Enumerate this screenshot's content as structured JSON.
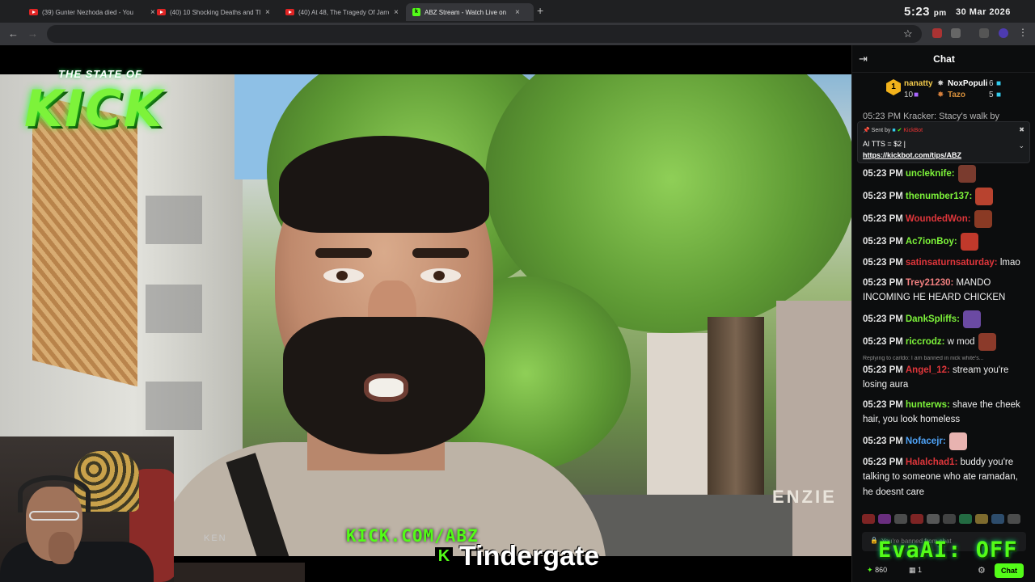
{
  "browser": {
    "tabs": [
      {
        "title": "(39) Gunter Nezhoda died - You",
        "icon": "youtube-icon"
      },
      {
        "title": "(40) 10 Shocking Deaths and Th",
        "icon": "youtube-icon"
      },
      {
        "title": "(40) At 48, The Tragedy Of Jarro",
        "icon": "youtube-icon"
      },
      {
        "title": "ABZ Stream - Watch Live on",
        "icon": "kick-icon"
      }
    ],
    "new_tab": "+",
    "close": "×"
  },
  "overlay": {
    "clock_time": "5:23",
    "clock_ampm": "pm",
    "date": "30 Mar 2026",
    "logo_top": "THE STATE OF",
    "logo_main": "KICK",
    "kick_url": "KICK.COM/ABZ",
    "caption_k": "K",
    "caption": "Tindergate",
    "eva_ai": "EvaAI: OFF",
    "video_sign": "ENZIE",
    "video_watermark": "KEN"
  },
  "chat": {
    "title": "Chat",
    "leaderboard": {
      "rank": "1",
      "first": {
        "name": "nanatty",
        "count": "10"
      },
      "second": {
        "name": "NoxPopuli",
        "count": "6"
      },
      "third": {
        "name": "Tazo",
        "count": "5"
      }
    },
    "behind_message": "05:23 PM Kracker: Stacy's walk by",
    "pinned": {
      "sent_by": "Sent by",
      "bot": "KickBot",
      "line": "AI TTS = $2 |",
      "link": "https://kickbot.com/tips/ABZ"
    },
    "messages": [
      {
        "time": "05:23 PM",
        "user": "uncleknife:",
        "color": "#7df33a",
        "text": "",
        "emote": "#7a3b2e"
      },
      {
        "time": "05:23 PM",
        "user": "thenumber137:",
        "color": "#7df33a",
        "text": "",
        "emote": "#b8432f"
      },
      {
        "time": "05:23 PM",
        "user": "WoundedWon:",
        "color": "#e0363b",
        "text": "",
        "emote": "#8a3a24"
      },
      {
        "time": "05:23 PM",
        "user": "Ac7ionBoy:",
        "color": "#7df33a",
        "text": "",
        "emote": "#c0392b"
      },
      {
        "time": "05:23 PM",
        "user": "satinsaturnsaturday:",
        "color": "#e0363b",
        "text": "lmao",
        "emote": ""
      },
      {
        "time": "05:23 PM",
        "user": "Trey21230:",
        "color": "#f07f7f",
        "text": "MANDO INCOMING HE HEARD CHICKEN",
        "emote": ""
      },
      {
        "time": "05:23 PM",
        "user": "DankSpliffs:",
        "color": "#7df33a",
        "text": "",
        "emote": "#6b4aa3"
      },
      {
        "time": "05:23 PM",
        "user": "riccrodz:",
        "color": "#7df33a",
        "text": "w mod",
        "emote": "#8b3a2a"
      },
      {
        "time": "05:23 PM",
        "user": "Angel_12:",
        "color": "#e0363b",
        "text": "stream you're losing aura",
        "emote": "",
        "reply": "Replying to carldo: I am banned in nick white's..."
      },
      {
        "time": "05:23 PM",
        "user": "hunterws:",
        "color": "#7df33a",
        "text": "shave the cheek hair, you look homeless",
        "emote": ""
      },
      {
        "time": "05:23 PM",
        "user": "Nofacejr:",
        "color": "#4fa3f7",
        "text": "",
        "emote": "#e8b3b0"
      },
      {
        "time": "05:23 PM",
        "user": "Halalchad1:",
        "color": "#e0363b",
        "text": "buddy you're talking to someone who ate ramadan, he doesnt care",
        "emote": ""
      }
    ],
    "banned_text": "You're banned from chat",
    "footer": {
      "coins": "860",
      "gifts": "1",
      "chat_button": "Chat"
    }
  },
  "colors": {
    "kick_green": "#53fc18",
    "chat_bg": "#0c0d0e",
    "username_red": "#e0363b"
  }
}
